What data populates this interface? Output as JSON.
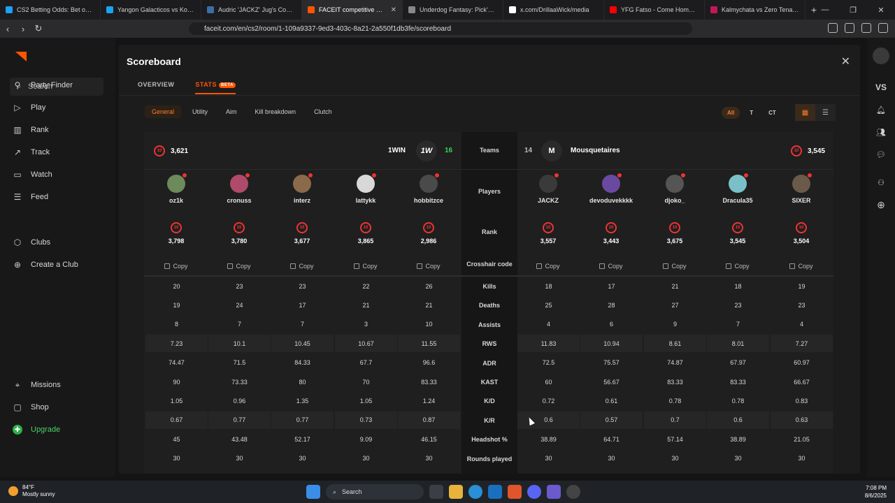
{
  "browser": {
    "tabs": [
      {
        "title": "CS2 Betting Odds: Bet on CS2",
        "color": "#1da1f2",
        "active": false
      },
      {
        "title": "Yangon Galacticos vs Kopite - …",
        "color": "#1da1f2",
        "active": false
      },
      {
        "title": "Audric 'JACKZ' Jug's Counter-S…",
        "color": "#3a6ea5",
        "active": false
      },
      {
        "title": "FACEIT competitive match",
        "color": "#ff5500",
        "active": true
      },
      {
        "title": "Underdog Fantasy: Pick'em - S…",
        "color": "#888888",
        "active": false
      },
      {
        "title": "x.com/DrillaaWick/media",
        "color": "#ffffff",
        "active": false
      },
      {
        "title": "YFG Fatso - Come Home (C…",
        "color": "#ff0000",
        "active": false
      },
      {
        "title": "Kalmychata vs Zero Tenacity - …",
        "color": "#c2185b",
        "active": false
      }
    ],
    "url": "faceit.com/en/cs2/room/1-109a9337-9ed3-403c-8a21-2a550f1db3fe/scoreboard"
  },
  "sidebar": {
    "search_label": "Search",
    "items": [
      {
        "label": "Party Finder",
        "icon": "party-finder-icon"
      },
      {
        "label": "Play",
        "icon": "play-icon"
      },
      {
        "label": "Rank",
        "icon": "rank-icon"
      },
      {
        "label": "Track",
        "icon": "track-icon"
      },
      {
        "label": "Watch",
        "icon": "watch-icon"
      },
      {
        "label": "Feed",
        "icon": "feed-icon"
      },
      {
        "label": "Clubs",
        "icon": "clubs-icon"
      },
      {
        "label": "Create a Club",
        "icon": "create-club-icon"
      },
      {
        "label": "Missions",
        "icon": "missions-icon"
      },
      {
        "label": "Shop",
        "icon": "shop-icon"
      },
      {
        "label": "Upgrade",
        "icon": "upgrade-icon"
      }
    ]
  },
  "rail": {
    "vs_label": "VS"
  },
  "modal": {
    "title": "Scoreboard",
    "tabs": [
      {
        "label": "OVERVIEW"
      },
      {
        "label": "STATS",
        "badge": "BETA"
      }
    ],
    "subtabs": [
      "General",
      "Utility",
      "Aim",
      "Kill breakdown",
      "Clutch"
    ],
    "side_filter": [
      "All",
      "T",
      "CT"
    ]
  },
  "scoreboard": {
    "labels": {
      "teams": "Teams",
      "players": "Players",
      "rank": "Rank",
      "crosshair": "Crosshair code",
      "stats": [
        "Kills",
        "Deaths",
        "Assists",
        "RWS",
        "ADR",
        "KAST",
        "K/D",
        "K/R",
        "Headshot %",
        "Rounds played"
      ]
    },
    "copy_label": "Copy",
    "team1": {
      "name": "1WIN",
      "logo_text": "1W",
      "score": "16",
      "avg_elo": "3,621",
      "level": "10",
      "players": [
        {
          "name": "oz1k",
          "elo": "3,798",
          "avatar": "#6d8a5a"
        },
        {
          "name": "cronuss",
          "elo": "3,780",
          "avatar": "#b04a6a"
        },
        {
          "name": "interz",
          "elo": "3,677",
          "avatar": "#8a6a4a"
        },
        {
          "name": "lattykk",
          "elo": "3,865",
          "avatar": "#d8d8d8"
        },
        {
          "name": "hobbitzce",
          "elo": "2,986",
          "avatar": "#4a4a4a"
        }
      ],
      "stats": [
        [
          "20",
          "23",
          "23",
          "22",
          "26"
        ],
        [
          "19",
          "24",
          "17",
          "21",
          "21"
        ],
        [
          "8",
          "7",
          "7",
          "3",
          "10"
        ],
        [
          "7.23",
          "10.1",
          "10.45",
          "10.67",
          "11.55"
        ],
        [
          "74.47",
          "71.5",
          "84.33",
          "67.7",
          "96.6"
        ],
        [
          "90",
          "73.33",
          "80",
          "70",
          "83.33"
        ],
        [
          "1.05",
          "0.96",
          "1.35",
          "1.05",
          "1.24"
        ],
        [
          "0.67",
          "0.77",
          "0.77",
          "0.73",
          "0.87"
        ],
        [
          "45",
          "43.48",
          "52.17",
          "9.09",
          "46.15"
        ],
        [
          "30",
          "30",
          "30",
          "30",
          "30"
        ]
      ]
    },
    "team2": {
      "name": "Mousquetaires",
      "logo_text": "M",
      "score": "14",
      "avg_elo": "3,545",
      "level": "10",
      "players": [
        {
          "name": "JACKZ",
          "elo": "3,557",
          "avatar": "#3a3a3a"
        },
        {
          "name": "devoduvekkkk",
          "elo": "3,443",
          "avatar": "#6a4aa0"
        },
        {
          "name": "djoko_",
          "elo": "3,675",
          "avatar": "#555555"
        },
        {
          "name": "Dracula35",
          "elo": "3,545",
          "avatar": "#7ac0c8"
        },
        {
          "name": "SIXER",
          "elo": "3,504",
          "avatar": "#6a5a4a"
        }
      ],
      "stats": [
        [
          "18",
          "17",
          "21",
          "18",
          "19"
        ],
        [
          "25",
          "28",
          "27",
          "23",
          "23"
        ],
        [
          "4",
          "6",
          "9",
          "7",
          "4"
        ],
        [
          "11.83",
          "10.94",
          "8.61",
          "8.01",
          "7.27"
        ],
        [
          "72.5",
          "75.57",
          "74.87",
          "67.97",
          "60.97"
        ],
        [
          "60",
          "56.67",
          "83.33",
          "83.33",
          "66.67"
        ],
        [
          "0.72",
          "0.61",
          "0.78",
          "0.78",
          "0.83"
        ],
        [
          "0.6",
          "0.57",
          "0.7",
          "0.6",
          "0.63"
        ],
        [
          "38.89",
          "64.71",
          "57.14",
          "38.89",
          "21.05"
        ],
        [
          "30",
          "30",
          "30",
          "30",
          "30"
        ]
      ]
    }
  },
  "taskbar": {
    "weather_temp": "84°F",
    "weather_desc": "Mostly sunny",
    "search_label": "Search",
    "time": "7:08 PM",
    "date": "8/6/2025"
  }
}
